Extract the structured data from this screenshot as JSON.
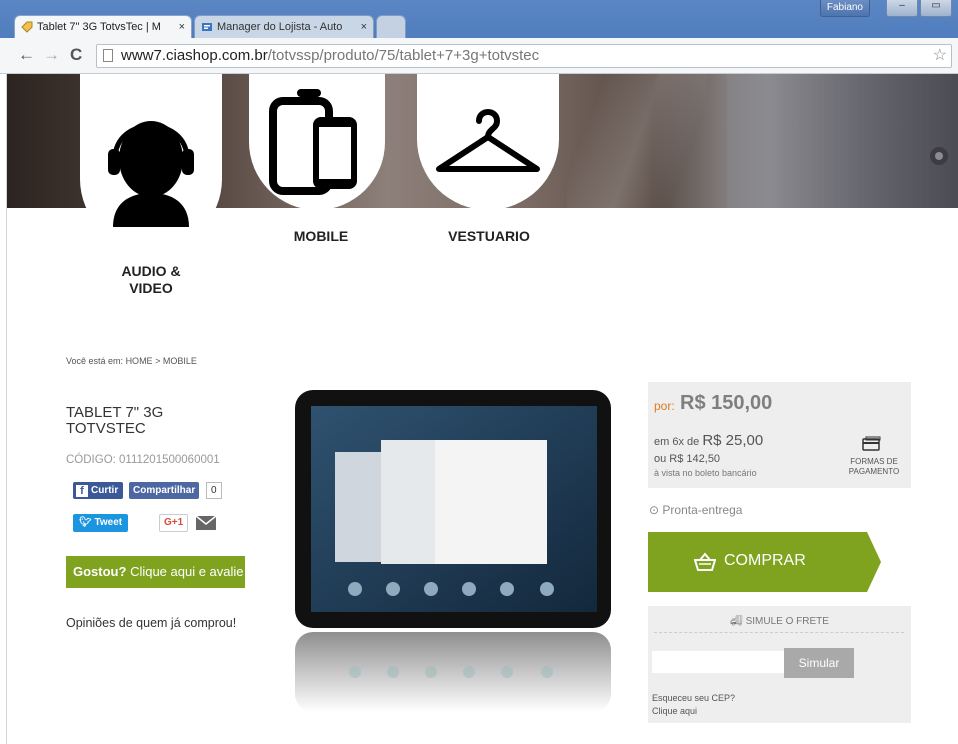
{
  "browser": {
    "tabs": [
      {
        "title": "Tablet 7\" 3G TotvsTec | M",
        "close": "×"
      },
      {
        "title": "Manager do Lojista - Auto",
        "close": "×"
      }
    ],
    "user": "Fabiano",
    "url_host": "www7.ciashop.com.br",
    "url_path": "/totvssp/produto/75/tablet+7+3g+totvstec"
  },
  "categories": [
    {
      "label_line1": "AUDIO &",
      "label_line2": "VIDEO",
      "icon": "headphones-person-icon"
    },
    {
      "label": "MOBILE",
      "icon": "devices-icon"
    },
    {
      "label": "VESTUARIO",
      "icon": "hanger-icon"
    }
  ],
  "breadcrumb": {
    "prefix": "Você está em:",
    "home": "HOME",
    "separator": ">",
    "current": "MOBILE"
  },
  "product": {
    "title": "TABLET 7\" 3G TOTVSTEC",
    "code": "CÓDIGO: 0111201500060001"
  },
  "social": {
    "fb_like": "Curtir",
    "fb_share": "Compartilhar",
    "fb_count": "0",
    "tweet": "Tweet",
    "gplus": "G+1"
  },
  "review": {
    "bold": "Gostou?",
    "text": "Clique aqui e avalie"
  },
  "opinions": "Opiniões de quem já comprou!",
  "price": {
    "por": "por:",
    "value": "R$ 150,00",
    "installment_prefix": "em 6x de",
    "installment_value": "R$ 25,00",
    "boleto": "ou R$ 142,50",
    "boleto_note": "à vista no boleto bancário",
    "payment_label": "FORMAS DE PAGAMENTO"
  },
  "stock": "Pronta-entrega",
  "buy_label": "COMPRAR",
  "shipping": {
    "title": "SIMULE O FRETE",
    "cep_value": "",
    "simulate": "Simular",
    "forgot_line1": "Esqueceu seu CEP?",
    "forgot_line2": "Clique aqui"
  },
  "colors": {
    "accent": "#7fa31f",
    "price_orange": "#e07a1e"
  }
}
